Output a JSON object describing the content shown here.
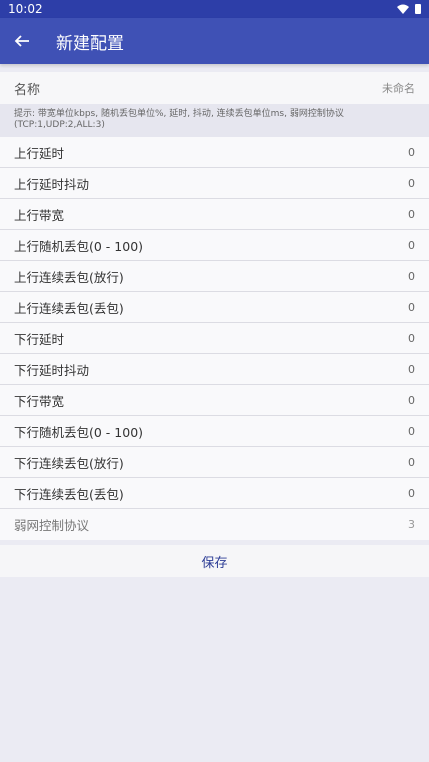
{
  "status_bar": {
    "time": "10:02"
  },
  "app_bar": {
    "title": "新建配置"
  },
  "name_field": {
    "label": "名称",
    "value": "未命名"
  },
  "hint": {
    "text": "提示: 带宽单位kbps, 随机丢包单位%, 延时, 抖动, 连续丢包单位ms, 弱网控制协议(TCP:1,UDP:2,ALL:3)"
  },
  "settings": [
    {
      "label": "上行延时",
      "value": "0"
    },
    {
      "label": "上行延时抖动",
      "value": "0"
    },
    {
      "label": "上行带宽",
      "value": "0"
    },
    {
      "label": "上行随机丢包(0 - 100)",
      "value": "0"
    },
    {
      "label": "上行连续丢包(放行)",
      "value": "0"
    },
    {
      "label": "上行连续丢包(丢包)",
      "value": "0"
    },
    {
      "label": "下行延时",
      "value": "0"
    },
    {
      "label": "下行延时抖动",
      "value": "0"
    },
    {
      "label": "下行带宽",
      "value": "0"
    },
    {
      "label": "下行随机丢包(0 - 100)",
      "value": "0"
    },
    {
      "label": "下行连续丢包(放行)",
      "value": "0"
    },
    {
      "label": "下行连续丢包(丢包)",
      "value": "0"
    },
    {
      "label": "弱网控制协议",
      "value": "3"
    }
  ],
  "save_button": {
    "label": "保存"
  },
  "colors": {
    "primary": "#3f51b5",
    "primary_dark": "#2d3ea8",
    "accent_text": "#2c3c95"
  },
  "icons": {
    "back": "arrow-left-icon",
    "wifi": "wifi-icon",
    "battery": "battery-icon"
  }
}
